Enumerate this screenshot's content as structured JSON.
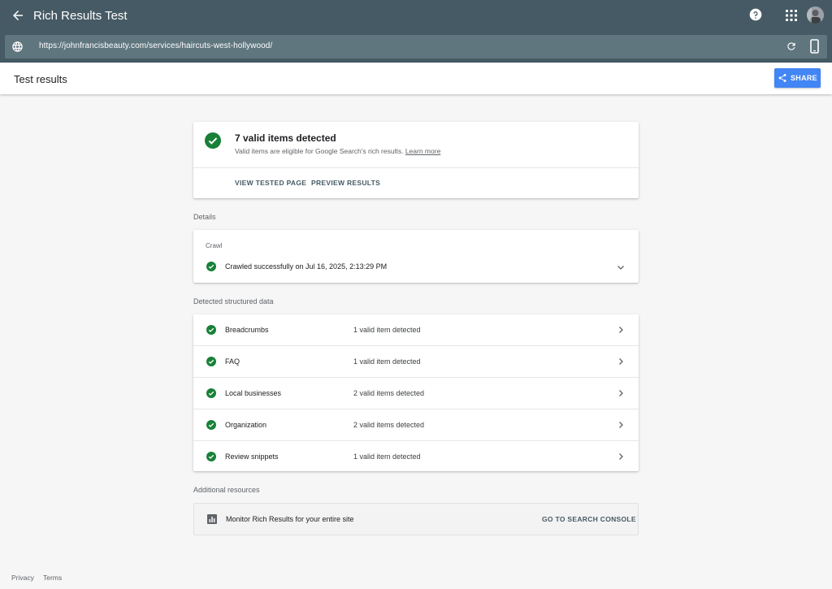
{
  "app": {
    "title": "Rich Results Test",
    "url": "https://johnfrancisbeauty.com/services/haircuts-west-hollywood/"
  },
  "subheader": {
    "title": "Test results",
    "share_label": "SHARE"
  },
  "summary": {
    "headline": "7 valid items detected",
    "subtitle": "Valid items are eligible for Google Search's rich results.",
    "learn_more": "Learn more",
    "actions": [
      "VIEW TESTED PAGE",
      "PREVIEW RESULTS"
    ]
  },
  "sections": {
    "details": "Details",
    "structured": "Detected structured data",
    "resources": "Additional resources"
  },
  "crawl": {
    "label": "Crawl",
    "status": "Crawled successfully on Jul 16, 2025, 2:13:29 PM"
  },
  "structured_data": [
    {
      "name": "Breadcrumbs",
      "count": "1 valid item detected"
    },
    {
      "name": "FAQ",
      "count": "1 valid item detected"
    },
    {
      "name": "Local businesses",
      "count": "2 valid items detected"
    },
    {
      "name": "Organization",
      "count": "2 valid items detected"
    },
    {
      "name": "Review snippets",
      "count": "1 valid item detected"
    }
  ],
  "resource": {
    "text": "Monitor Rich Results for your entire site",
    "action": "GO TO SEARCH CONSOLE"
  },
  "footer": {
    "privacy": "Privacy",
    "terms": "Terms"
  },
  "colors": {
    "appbar": "#455a64",
    "urlbar": "#5f767f",
    "success": "#188038",
    "share": "#4285f4"
  }
}
